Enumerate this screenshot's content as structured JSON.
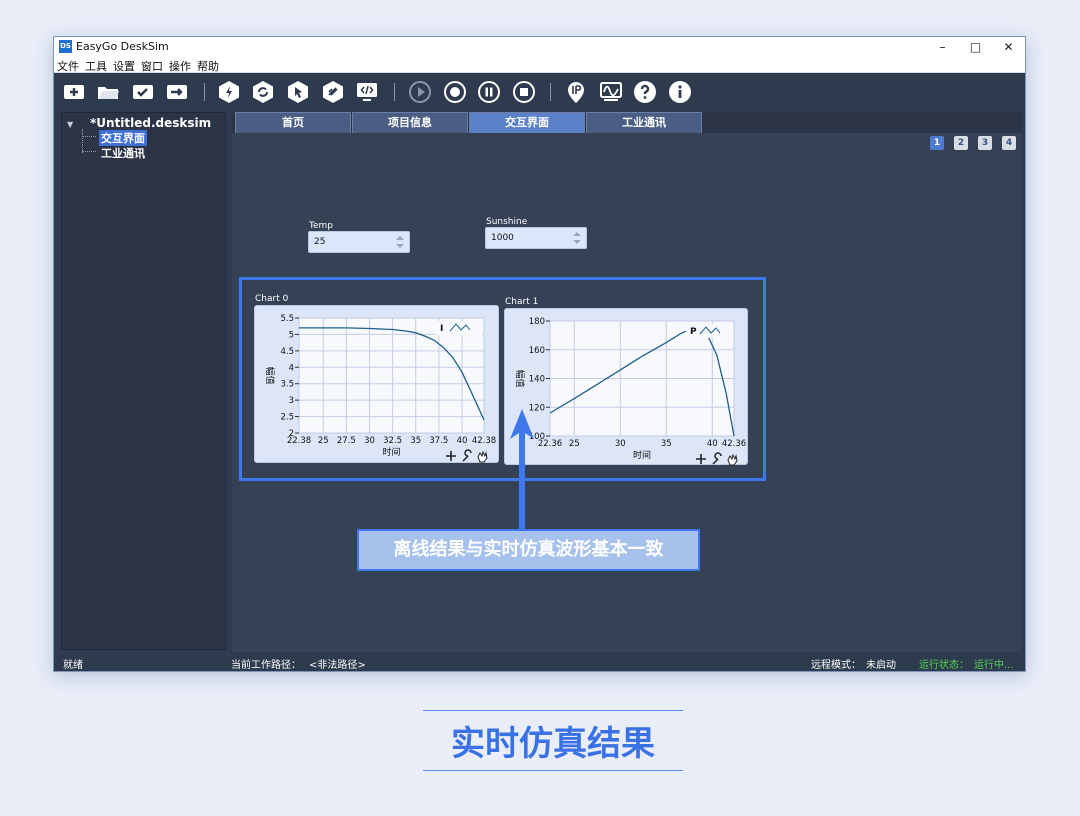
{
  "window": {
    "app_logo": "DS",
    "title": "EasyGo DeskSim",
    "controls": [
      "minimize-icon",
      "maximize-icon",
      "close-icon"
    ]
  },
  "menu": [
    "文件",
    "工具",
    "设置",
    "窗口",
    "操作",
    "帮助"
  ],
  "toolbar": {
    "groups": [
      [
        "new-file-icon",
        "open-folder-icon",
        "save-icon",
        "export-icon"
      ],
      [
        "build-icon",
        "refresh-icon",
        "pointer-icon",
        "deploy-icon",
        "code-monitor-icon"
      ],
      [
        "run-icon",
        "record-icon",
        "pause-icon",
        "stop-icon"
      ],
      [
        "ip-icon",
        "scope-icon",
        "help-icon",
        "info-icon"
      ]
    ]
  },
  "tree": {
    "root": "*Untitled.desksim",
    "children": [
      "交互界面",
      "工业通讯"
    ],
    "selected_index": 0
  },
  "tabs": {
    "labels": [
      "首页",
      "项目信息",
      "交互界面",
      "工业通讯"
    ],
    "active_index": 2
  },
  "pages": {
    "labels": [
      "1",
      "2",
      "3",
      "4"
    ],
    "active_index": 0
  },
  "controls": {
    "temp": {
      "label": "Temp",
      "value": "25"
    },
    "sunshine": {
      "label": "Sunshine",
      "value": "1000"
    }
  },
  "chart_data": [
    {
      "type": "line",
      "title": "Chart 0",
      "xlabel": "时间",
      "ylabel": "幅值",
      "legend_label": "I",
      "xlim": [
        22.38,
        42.38
      ],
      "ylim": [
        2,
        5.5
      ],
      "xticks": [
        "22.38",
        "25",
        "27.5",
        "30",
        "32.5",
        "35",
        "37.5",
        "40",
        "42.38"
      ],
      "yticks": [
        "2",
        "2.5",
        "3",
        "3.5",
        "4",
        "4.5",
        "5",
        "5.5"
      ],
      "grid": true,
      "x": [
        22.38,
        25,
        27.5,
        30,
        32.5,
        34,
        35,
        36,
        37,
        38,
        39,
        40,
        41,
        42.38
      ],
      "y": [
        5.2,
        5.2,
        5.2,
        5.18,
        5.15,
        5.1,
        5.05,
        4.95,
        4.82,
        4.6,
        4.3,
        3.85,
        3.25,
        2.4
      ]
    },
    {
      "type": "line",
      "title": "Chart 1",
      "xlabel": "时间",
      "ylabel": "幅值",
      "legend_label": "P",
      "xlim": [
        22.36,
        42.36
      ],
      "ylim": [
        100,
        180
      ],
      "xticks": [
        "22.36",
        "25",
        "30",
        "35",
        "40",
        "42.36"
      ],
      "yticks": [
        "100",
        "120",
        "140",
        "160",
        "180"
      ],
      "grid": true,
      "x": [
        22.36,
        25,
        27.5,
        30,
        32.5,
        35,
        36.5,
        37.5,
        38.5,
        39.5,
        40.5,
        41.5,
        42.36
      ],
      "y": [
        116,
        126,
        136,
        146,
        156,
        165,
        171,
        174,
        174,
        170,
        156,
        130,
        100
      ]
    }
  ],
  "callout": "离线结果与实时仿真波形基本一致",
  "statusbar": {
    "ready": "就绪",
    "path_label": "当前工作路径：",
    "path_value": "<非法路径>",
    "remote_label": "远程模式：",
    "remote_value": "未启动",
    "run_label": "运行状态：",
    "run_value": "运行中..."
  },
  "caption": "实时仿真结果",
  "colors": {
    "accent": "#3f78ea",
    "panel": "#2e3a4d",
    "curve": "#1f5f8b",
    "status_ok": "#55d455"
  }
}
